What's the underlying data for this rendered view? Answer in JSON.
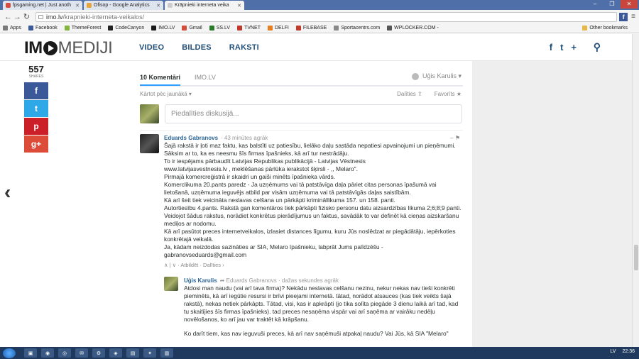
{
  "tabs": [
    {
      "label": "fpsgaming.net | Just anoth",
      "color": "#d44c3c",
      "active": false
    },
    {
      "label": "Ofisop - Google Analytics",
      "color": "#e8a33c",
      "active": false
    },
    {
      "label": "Krāpnieki interneta veika",
      "color": "#cccccc",
      "active": true
    }
  ],
  "omnibar": {
    "host": "imo.lv",
    "path": "/krapnieki-interneta-veikalos/"
  },
  "bookmarks": [
    {
      "label": "Apps",
      "color": "#7b7b7b"
    },
    {
      "label": "Facebook",
      "color": "#3b5998"
    },
    {
      "label": "ThemeForest",
      "color": "#82b440"
    },
    {
      "label": "CodeCanyon",
      "color": "#222222"
    },
    {
      "label": "IMO.LV",
      "color": "#1a1a1a"
    },
    {
      "label": "Gmail",
      "color": "#d44c3c"
    },
    {
      "label": "SS.LV",
      "color": "#2c7a2c"
    },
    {
      "label": "TVNET",
      "color": "#c0392b"
    },
    {
      "label": "DELFI",
      "color": "#e67e22"
    },
    {
      "label": "FILEBASE",
      "color": "#c0392b"
    },
    {
      "label": "Sportacentrs.com",
      "color": "#888888"
    },
    {
      "label": "WPLOCKER.COM -",
      "color": "#555555"
    }
  ],
  "bookmarks_other": "Other bookmarks",
  "site": {
    "logo_a": "IM",
    "logo_b": "MEDIJI",
    "nav": [
      "VIDEO",
      "BILDES",
      "RAKSTI"
    ],
    "icons": [
      "f",
      "t",
      "+"
    ],
    "search": "⚲"
  },
  "share": {
    "count": "557",
    "label": "SHARES",
    "buttons": [
      {
        "glyph": "f",
        "color": "#3b5998"
      },
      {
        "glyph": "t",
        "color": "#2fa8e8"
      },
      {
        "glyph": "p",
        "color": "#cb2027"
      },
      {
        "glyph": "g+",
        "color": "#dd4b39"
      }
    ]
  },
  "disqus": {
    "tab_comments": "10 Komentāri",
    "tab_site": "IMO.LV",
    "user": "Uģis Karulis ▾",
    "sort": "Kārtot pēc jaunākā ▾",
    "share": "Dalīties ⇪",
    "favorite": "Favorīts ★",
    "input_placeholder": "Piedalīties diskusijā...",
    "post": {
      "author": "Eduards Gabranovs",
      "time": "· 43 minūtes agrāk",
      "controls": "–  ⚑",
      "lines": [
        "Šajā rakstā ir ļoti maz faktu, kas balstīti uz patiesību, lielāko daļu sastāda nepatiesi apvainojumi un pieņēmumi.",
        "Sāksim ar to, ka es neesmu šīs firmas īpašnieks, kā arī tur nestrādāju.",
        "To ir iespējams pārbaudīt Latvijas Republikas publikācijā - Latvijas Vēstnesis",
        "www.latvijasvestnesis.lv , meklēšanas pārlūka ierakstot šķirsli - ,, Melaro\".",
        "Pirmajā komercreģistrā ir skaidri un gaiši minēts īpašnieka vārds.",
        "Komerclikuma 20.pants paredz - Ja uzņēmums vai tā patstāvīga daļa pāriet citas personas īpašumā vai lietošanā, uzņēmuma ieguvējs atbild par visām uzņēmuma vai tā patstāvīgās daļas saistībām.",
        "Kā arī šeit tiek veicināta neslavas celšana un pārkāpti krimināllikuma 157. un 158. panti.",
        "Autortiesību 4.pants. Rakstā gan komentāros tiek pārkāpti fizisko personu datu aizsardzības likuma 2;6;8;9 panti.",
        "Veidojot šādus rakstus, norādiet konkrētus pierādījumus un faktus, savādāk to var definēt kā cieņas aizskaršanu mediļos ar nodomu.",
        "Kā arī pasūtot preces internetveikalos, izlasiet distances līgumu, kuru Jūs noslēdzat ar piegādātāju, iepērkoties konkrētajā veikalā.",
        "Ja, kādam neizdodas sazināties ar SIA, Melaro īpašnieku, labprāt Jums palīdzēšu -",
        "gabranovseduards@gmail.com"
      ],
      "actions": "∧ | ∨ · Atbildēt · Dalīties ›"
    },
    "reply": {
      "author": "Uģis Karulis",
      "to": "➦ Eduards Gabranovs",
      "time": "· dažas sekundes agrāk",
      "lines": [
        "Atdosi man naudu (vai arī tava firma)? Nekādu neslavas celšanu nezinu, nekur nekas nav tieši konkrēti pieminēts, kā arī iegūtie resursi ir brīvi pieejami internetā. tātad, norādot atsauces (kas tiek veikts šajā rakstā), nekas netiek pārkāpts. Tātad, visi, kas ir apkrāpti (jo tika solīta piegāde 3 dienu laikā arī tad, kad tu skaitījies šīs firmas īpašnieks). tad preces nesaņēma vispār vai arī saņēma ar vairāku nedēļu novēlošanos, ko arī jau var traktēt kā krāpšanu.",
        "Ko darīt tiem, kas nav ieguvuši preces, kā arī nav saņēmuši atpakaļ naudu? Vai Jūs, kā SIA \"Melaro\""
      ]
    }
  },
  "taskbar": {
    "items": [
      "▣",
      "◉",
      "◎",
      "✉",
      "⚙",
      "◈",
      "▤",
      "✦",
      "▥"
    ],
    "lang": "LV",
    "time": "22:36"
  },
  "window_controls": [
    "–",
    "❐",
    "✕"
  ]
}
